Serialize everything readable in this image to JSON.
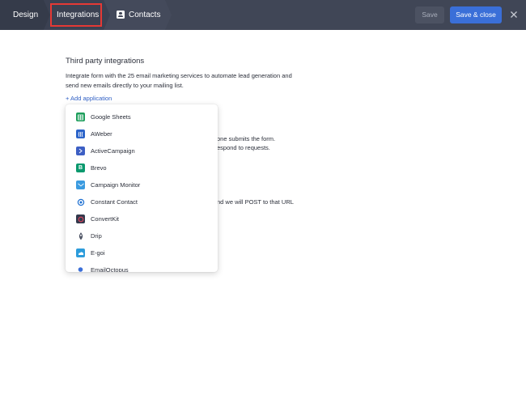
{
  "header": {
    "tabs": [
      {
        "label": "Design"
      },
      {
        "label": "Integrations"
      },
      {
        "label": "Contacts"
      }
    ],
    "save_label": "Save",
    "save_close_label": "Save & close"
  },
  "main": {
    "heading": "Third party integrations",
    "description": "Integrate form with the 25 email marketing services to automate lead generation and send new emails directly to your mailing list.",
    "add_application": "+ Add application",
    "partial_lines": [
      "one submits the form.",
      "espond to requests.",
      "nd we will POST to that URL"
    ]
  },
  "dropdown": {
    "items": [
      {
        "label": "Google Sheets",
        "icon": "google-sheets-icon",
        "color": "#1e9e5c"
      },
      {
        "label": "AWeber",
        "icon": "aweber-icon",
        "color": "#2b63c9"
      },
      {
        "label": "ActiveCampaign",
        "icon": "activecampaign-icon",
        "color": "#3d5fc4"
      },
      {
        "label": "Brevo",
        "icon": "brevo-icon",
        "color": "#0b996e"
      },
      {
        "label": "Campaign Monitor",
        "icon": "campaign-monitor-icon",
        "color": "#3b9be0"
      },
      {
        "label": "Constant Contact",
        "icon": "constant-contact-icon",
        "color": "#1d6fd1"
      },
      {
        "label": "ConvertKit",
        "icon": "convertkit-icon",
        "color": "#e2445c"
      },
      {
        "label": "Drip",
        "icon": "drip-icon",
        "color": "#333a4d"
      },
      {
        "label": "E-goi",
        "icon": "egoi-icon",
        "color": "#2d9cdb"
      },
      {
        "label": "EmailOctopus",
        "icon": "emailoctopus-icon",
        "color": "#3b6fd8"
      }
    ]
  },
  "colors": {
    "topbar": "#404656",
    "accent": "#3a6fd8",
    "link": "#2f5fc4",
    "highlight": "#e53935"
  }
}
